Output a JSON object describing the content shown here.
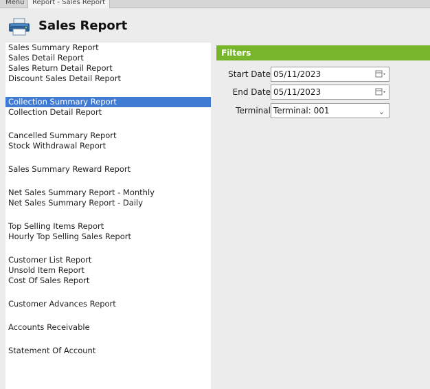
{
  "tabs": [
    "Menu",
    "Report - Sales Report"
  ],
  "header": {
    "title": "Sales Report",
    "icon": "printer-icon"
  },
  "reports": [
    {
      "label": "Sales Summary Report",
      "selected": false
    },
    {
      "label": "Sales Detail Report",
      "selected": false
    },
    {
      "label": "Sales Return Detail Report",
      "selected": false
    },
    {
      "label": "Discount Sales Detail Report",
      "selected": false
    },
    {
      "gap": true
    },
    {
      "label": "Collection Summary Report",
      "selected": true
    },
    {
      "label": "Collection Detail Report",
      "selected": false
    },
    {
      "gap": true
    },
    {
      "label": "Cancelled Summary Report",
      "selected": false
    },
    {
      "label": "Stock Withdrawal Report",
      "selected": false
    },
    {
      "gap": true
    },
    {
      "label": "Sales Summary Reward Report",
      "selected": false
    },
    {
      "gap": true
    },
    {
      "label": "Net Sales Summary Report - Monthly",
      "selected": false
    },
    {
      "label": "Net Sales Summary Report - Daily",
      "selected": false
    },
    {
      "gap": true
    },
    {
      "label": "Top Selling Items Report",
      "selected": false
    },
    {
      "label": "Hourly Top Selling Sales Report",
      "selected": false
    },
    {
      "gap": true
    },
    {
      "label": "Customer List Report",
      "selected": false
    },
    {
      "label": "Unsold Item Report",
      "selected": false
    },
    {
      "label": "Cost Of Sales Report",
      "selected": false
    },
    {
      "gap": true
    },
    {
      "label": "Customer Advances Report",
      "selected": false
    },
    {
      "gap": true
    },
    {
      "label": "Accounts Receivable",
      "selected": false
    },
    {
      "gap": true
    },
    {
      "label": "Statement Of Account",
      "selected": false
    }
  ],
  "filters": {
    "title": "Filters",
    "start_date_label": "Start Date:",
    "start_date_value": "05/11/2023",
    "end_date_label": "End Date:",
    "end_date_value": "05/11/2023",
    "terminal_label": "Terminal:",
    "terminal_value": "Terminal: 001"
  },
  "colors": {
    "accent_green": "#77b62a",
    "selection_blue": "#3f7bd3"
  }
}
